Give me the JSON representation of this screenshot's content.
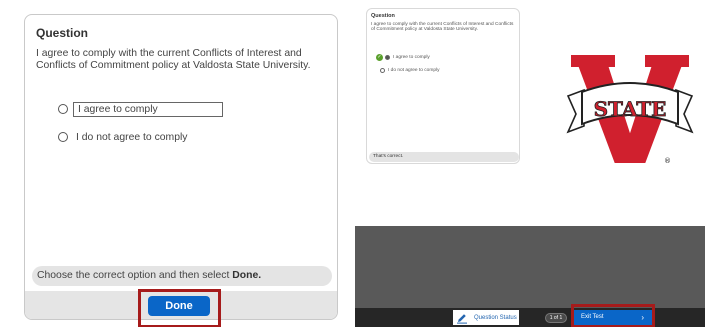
{
  "left_panel": {
    "title": "Question",
    "question": "I agree to comply with the current Conflicts of Interest and Conflicts of Commitment policy at Valdosta State University.",
    "options": [
      "I agree to comply",
      "I do not agree to comply"
    ],
    "instruction_text": "Choose the correct option and then select ",
    "instruction_bold": "Done.",
    "done_label": "Done",
    "highlight_color": "#a61b1b",
    "button_color": "#0a66c8"
  },
  "right_panel": {
    "title": "Question",
    "question": "I agree to comply with the current Conflicts of Interest and Conflicts of Commitment policy at Valdosta State University.",
    "options": [
      "I agree to comply",
      "I do not agree to comply"
    ],
    "selected_option": "I agree to comply",
    "feedback": "That's correct.",
    "logo": {
      "name": "valdosta-state-v-logo",
      "text": "STATE",
      "mark": "®",
      "primary_color": "#d0202e",
      "ribbon_color": "#ffffff"
    },
    "footer": {
      "question_status_label": "Question Status",
      "page_counter": "1 of 1",
      "exit_label": "Exit Test"
    }
  }
}
